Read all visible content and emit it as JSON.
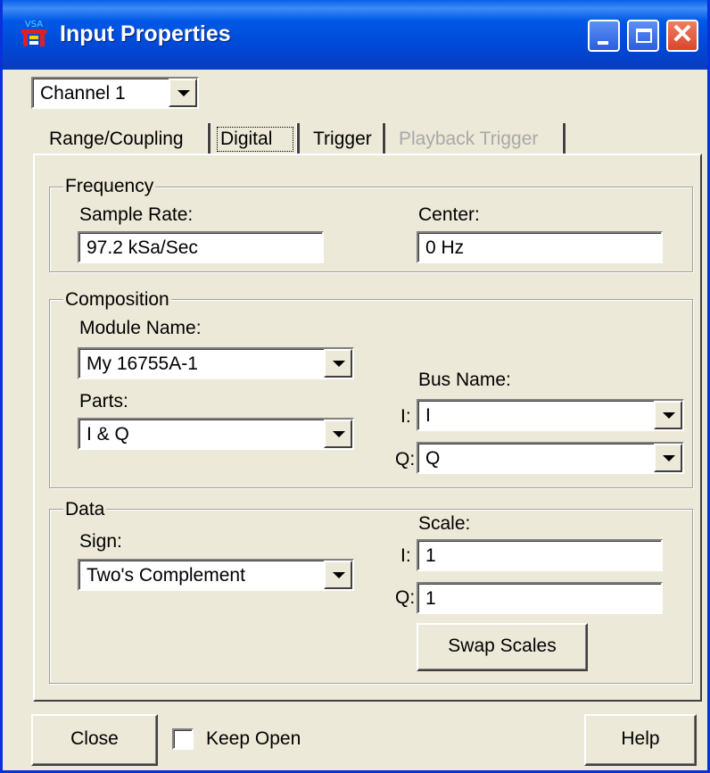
{
  "window": {
    "title": "Input Properties",
    "app_badge": "VSA",
    "controls": [
      "minimize",
      "maximize",
      "close"
    ]
  },
  "channel_select": {
    "value": "Channel 1"
  },
  "tabs": [
    {
      "label": "Range/Coupling",
      "active": false,
      "enabled": true
    },
    {
      "label": "Digital",
      "active": true,
      "enabled": true
    },
    {
      "label": "Trigger",
      "active": false,
      "enabled": true
    },
    {
      "label": "Playback Trigger",
      "active": false,
      "enabled": false
    }
  ],
  "frequency": {
    "title": "Frequency",
    "sample_rate_label": "Sample Rate:",
    "sample_rate_value": "97.2 kSa/Sec",
    "center_label": "Center:",
    "center_value": "0 Hz"
  },
  "composition": {
    "title": "Composition",
    "module_name_label": "Module Name:",
    "module_name_value": "My 16755A-1",
    "parts_label": "Parts:",
    "parts_value": "I & Q",
    "bus_name_label": "Bus Name:",
    "bus_i_label": "I:",
    "bus_i_value": "I",
    "bus_q_label": "Q:",
    "bus_q_value": "Q"
  },
  "data_group": {
    "title": "Data",
    "sign_label": "Sign:",
    "sign_value": "Two's Complement",
    "scale_label": "Scale:",
    "scale_i_label": "I:",
    "scale_i_value": "1",
    "scale_q_label": "Q:",
    "scale_q_value": "1",
    "swap_label": "Swap Scales"
  },
  "footer": {
    "close_label": "Close",
    "keep_open_label": "Keep Open",
    "keep_open_checked": false,
    "help_label": "Help"
  },
  "colors": {
    "titlebar": "#0058e6",
    "window_face": "#ece9d8",
    "close_button": "#d8462c"
  },
  "icons": [
    "app-icon",
    "minimize-icon",
    "maximize-icon",
    "close-icon",
    "chevron-down-icon"
  ]
}
